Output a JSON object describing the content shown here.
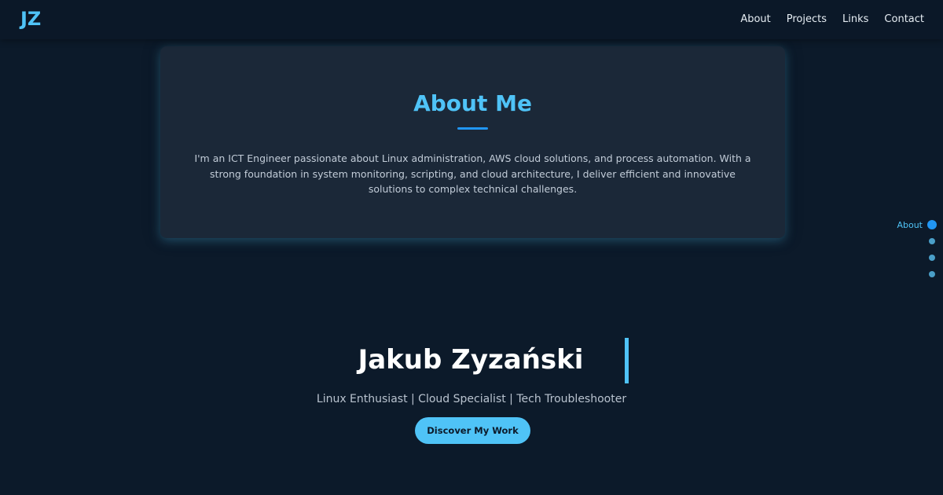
{
  "header": {
    "logo": "JZ",
    "nav": [
      "About",
      "Projects",
      "Links",
      "Contact"
    ]
  },
  "about": {
    "title": "About Me",
    "text": "I'm an ICT Engineer passionate about Linux administration, AWS cloud solutions, and process automation. With a strong foundation in system monitoring, scripting, and cloud architecture, I deliver efficient and innovative solutions to complex technical challenges."
  },
  "side_nav": {
    "active_label": "About"
  },
  "hero": {
    "name": "Jakub Zyzański",
    "subtitle": "Linux Enthusiast | Cloud Specialist | Tech Troubleshooter",
    "cta": "Discover My Work"
  },
  "colors": {
    "accent": "#4fc3f7",
    "background": "#0c1a2a",
    "card": "#1b2838"
  }
}
